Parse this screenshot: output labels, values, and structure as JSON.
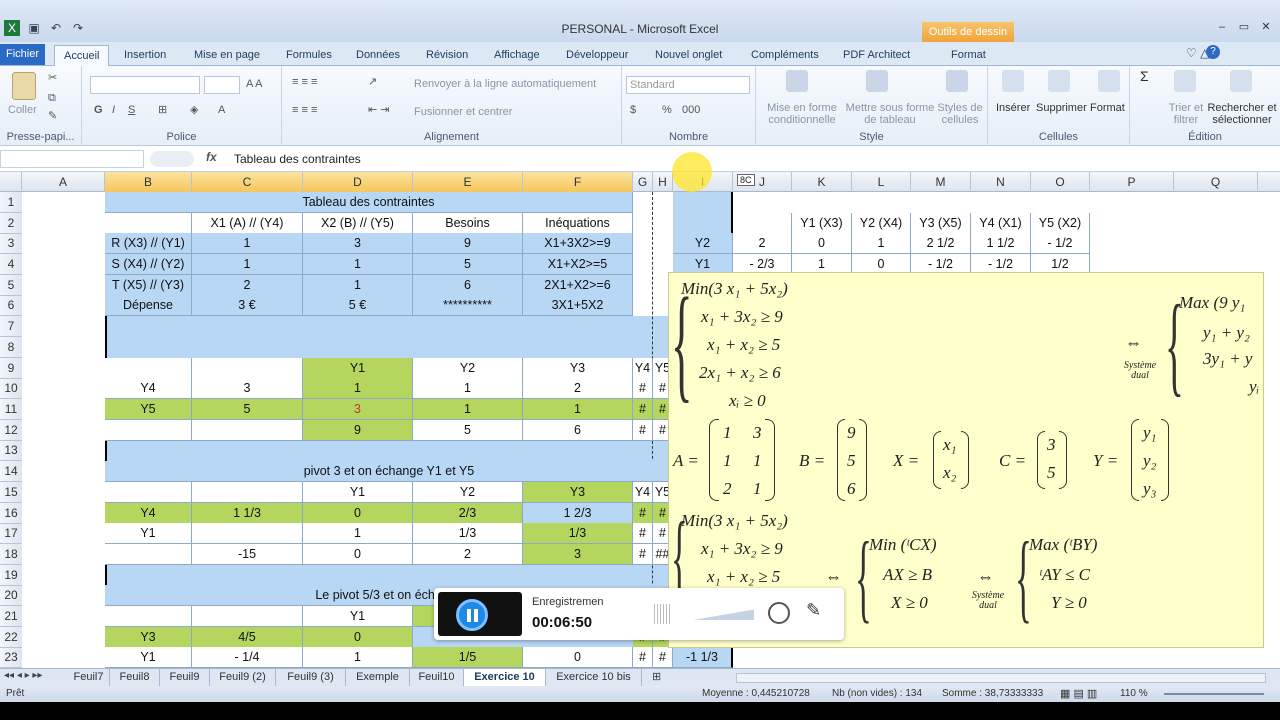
{
  "window": {
    "title": "PERSONAL - Microsoft Excel",
    "tools_tab": "Outils de dessin"
  },
  "tabs": [
    "Fichier",
    "Accueil",
    "Insertion",
    "Mise en page",
    "Formules",
    "Données",
    "Révision",
    "Affichage",
    "Développeur",
    "Nouvel onglet",
    "Compléments",
    "PDF Architect",
    "Format"
  ],
  "ribbon": {
    "clipboard": {
      "paste": "Coller",
      "label": "Presse-papi..."
    },
    "font": {
      "label": "Police"
    },
    "alignment": {
      "wrap": "Renvoyer à la ligne automatiquement",
      "merge": "Fusionner et centrer",
      "label": "Alignement"
    },
    "number": {
      "format": "Standard",
      "label": "Nombre",
      "pct": "%",
      "thousands": "000"
    },
    "styles": {
      "cond": "Mise en forme conditionnelle",
      "table": "Mettre sous forme de tableau",
      "cell": "Styles de cellules",
      "label": "Style"
    },
    "cells": {
      "insert": "Insérer",
      "delete": "Supprimer",
      "format": "Format",
      "label": "Cellules"
    },
    "editing": {
      "sort": "Trier et filtrer",
      "find": "Rechercher et sélectionner",
      "label": "Édition",
      "sigma": "Σ"
    }
  },
  "formula_bar": {
    "fx": "fx",
    "value": "Tableau des contraintes"
  },
  "columns": [
    "A",
    "B",
    "C",
    "D",
    "E",
    "F",
    "G",
    "H",
    "I",
    "J",
    "K",
    "L",
    "M",
    "N",
    "O",
    "P",
    "Q"
  ],
  "rows": [
    "1",
    "2",
    "3",
    "4",
    "5",
    "6",
    "7",
    "8",
    "9",
    "10",
    "11",
    "12",
    "13",
    "14",
    "15",
    "16",
    "17",
    "18",
    "19",
    "20",
    "21",
    "22",
    "23"
  ],
  "table": {
    "title": "Tableau des contraintes",
    "headers": [
      "X1 (A) // (Y4)",
      "X2 (B) // (Y5)",
      "Besoins",
      "Inéquations"
    ],
    "r3": [
      "R (X3) // (Y1)",
      "1",
      "3",
      "9",
      "X1+3X2>=9"
    ],
    "r4": [
      "S (X4) // (Y2)",
      "1",
      "1",
      "5",
      "X1+X2>=5"
    ],
    "r5": [
      "T (X5) // (Y3)",
      "2",
      "1",
      "6",
      "2X1+X2>=6"
    ],
    "r6": [
      "Dépense",
      "3 €",
      "5 €",
      "**********",
      "3X1+5X2"
    ],
    "r9": [
      "Y1",
      "Y2",
      "Y3",
      "Y4",
      "Y5"
    ],
    "r10": [
      "Y4",
      "3",
      "1",
      "1",
      "2",
      "#",
      "#"
    ],
    "r11": [
      "Y5",
      "5",
      "3",
      "1",
      "1",
      "#",
      "#"
    ],
    "r12": [
      "9",
      "5",
      "6",
      "#",
      "#"
    ],
    "r14": "pivot 3 et on échange Y1 et Y5",
    "r15": [
      "Y1",
      "Y2",
      "Y3",
      "Y4",
      "Y5"
    ],
    "r16": [
      "Y4",
      "1 1/3",
      "0",
      "2/3",
      "1 2/3",
      "#",
      "#"
    ],
    "r17": [
      "Y1",
      "1",
      "1/3",
      "1/3",
      "#",
      "#"
    ],
    "r18": [
      "-15",
      "0",
      "2",
      "3",
      "#",
      "##"
    ],
    "r20": "Le pivot 5/3 et on échange",
    "r21": [
      "Y1"
    ],
    "r22": [
      "Y3",
      "4/5",
      "0",
      "#",
      "#"
    ],
    "r23": [
      "Y1",
      "- 1/4",
      "1",
      "1/5",
      "0",
      "#",
      "#",
      "-1 1/3"
    ]
  },
  "right_table": {
    "headers": [
      "Y1 (X3)",
      "Y2 (X4)",
      "Y3 (X5)",
      "Y4 (X1)",
      "Y5 (X2)"
    ],
    "r3": [
      "Y2",
      "2",
      "0",
      "1",
      "2 1/2",
      "1 1/2",
      "- 1/2"
    ],
    "r4": [
      "Y1",
      "- 2/3",
      "1",
      "0",
      "- 1/2",
      "- 1/2",
      "1/2"
    ],
    "name_tag": "8C"
  },
  "math": {
    "min": "Min(3 x₁ + 5x₂)",
    "c1": "x₁ + 3x₂ ≥ 9",
    "c2": "x₁ + x₂ ≥ 5",
    "c3": "2x₁ + x₂ ≥ 6",
    "c4": "xᵢ ≥ 0",
    "max": "Max (9 y₁",
    "d1": "y₁ + y₂",
    "d2": "3y₁ + y",
    "d3": "yᵢ",
    "dual": "Système dual",
    "A": "A =",
    "Amat": [
      "1",
      "3",
      "1",
      "1",
      "2",
      "1"
    ],
    "B": "B =",
    "Bmat": [
      "9",
      "5",
      "6"
    ],
    "X": "X =",
    "Xmat": [
      "x₁",
      "x₂"
    ],
    "C": "C =",
    "Cmat": [
      "3",
      "5"
    ],
    "Y": "Y =",
    "Ymat": [
      "y₁",
      "y₂",
      "y₃"
    ],
    "min2": "Min(3 x₁ + 5x₂)",
    "c1b": "x₁ + 3x₂ ≥ 9",
    "c2b": "x₁ + x₂ ≥ 5",
    "minCX": "Min (ᵗCX)",
    "AX": "AX ≥ B",
    "X0": "X ≥ 0",
    "maxBY": "Max (ᵗBY)",
    "AY": "ᵗAY ≤ C",
    "Y0": "Y ≥ 0"
  },
  "recorder": {
    "label": "Enregistremen",
    "time": "00:06:50"
  },
  "sheets": [
    "Feuil7",
    "Feuil8",
    "Feuil9",
    "Feuil9 (2)",
    "Feuil9 (3)",
    "Exemple",
    "Feuil10",
    "Exercice 10",
    "Exercice 10 bis"
  ],
  "status": {
    "ready": "Prêt",
    "avg": "Moyenne : 0,445210728",
    "count": "Nb (non vides) : 134",
    "sum": "Somme : 38,73333333",
    "zoom": "110 %"
  }
}
